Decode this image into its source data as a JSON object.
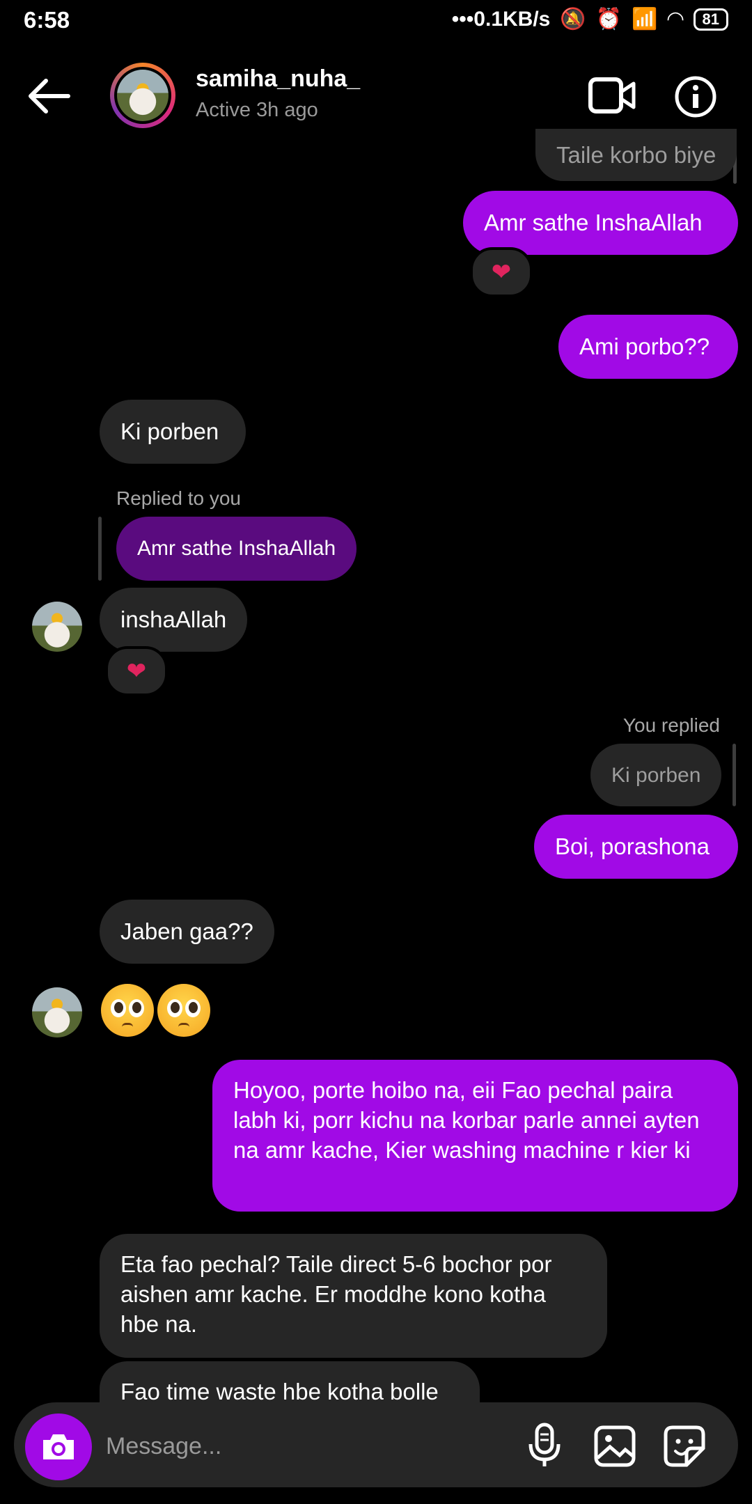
{
  "status": {
    "time": "6:58",
    "speed": "0.1KB/s",
    "battery": "81"
  },
  "header": {
    "username": "samiha_nuha_",
    "active": "Active 3h ago"
  },
  "messages": {
    "m0": "Taile korbo biye",
    "m1": "Amr sathe InshaAllah",
    "m1_reaction": "❤",
    "m2": "Ami porbo??",
    "m3": "Ki porben",
    "m4_label": "Replied to you",
    "m4_quote": "Amr sathe InshaAllah",
    "m4": "inshaAllah",
    "m4_reaction": "❤",
    "m5_label": "You replied",
    "m5_quote": "Ki porben",
    "m5": "Boi, porashona",
    "m6": "Jaben  gaa??",
    "m8": "Hoyoo, porte hoibo na, eii Fao pechal paira labh ki, porr kichu na korbar parle annei ayten na amr kache, Kier washing machine r kier ki",
    "m9": "Eta fao pechal? Taile direct 5-6 bochor por aishen amr kache. Er moddhe kono kotha hbe na.",
    "m10": "Fao time waste hbe kotha bolle"
  },
  "composer": {
    "placeholder": "Message..."
  },
  "icons": {
    "back": "back-arrow-icon",
    "video": "video-call-icon",
    "info": "info-icon",
    "camera": "camera-icon",
    "mic": "microphone-icon",
    "gallery": "gallery-icon",
    "sticker": "sticker-icon"
  },
  "colors": {
    "accent": "#a10ae6",
    "their_bubble": "#262626",
    "background": "#000000"
  }
}
